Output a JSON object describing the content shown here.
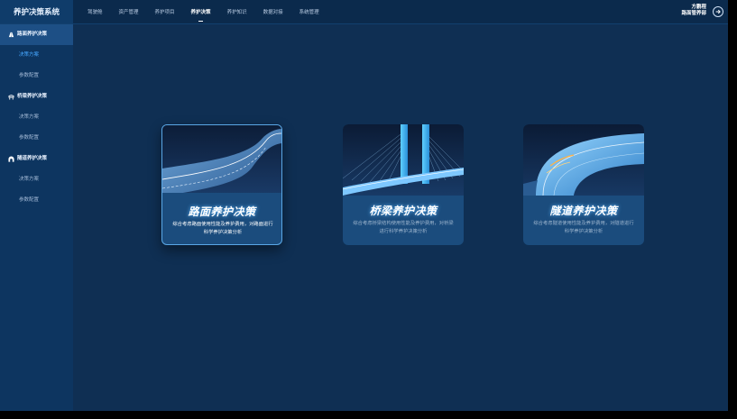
{
  "app": {
    "title": "养护决策系统"
  },
  "nav": {
    "tabs": [
      {
        "label": "驾驶舱"
      },
      {
        "label": "资产管理"
      },
      {
        "label": "养护项目"
      },
      {
        "label": "养护决策",
        "active": true
      },
      {
        "label": "养护知识"
      },
      {
        "label": "数据对接"
      },
      {
        "label": "系统管理"
      }
    ]
  },
  "user": {
    "name": "方鹏程",
    "org": "路面管养部"
  },
  "sidebar": {
    "groups": [
      {
        "label": "路面养护决策",
        "icon": "road-icon",
        "items": [
          {
            "label": "决策方案",
            "active": true
          },
          {
            "label": "参数配置"
          }
        ]
      },
      {
        "label": "桥梁养护决策",
        "icon": "bridge-icon",
        "items": [
          {
            "label": "决策方案"
          },
          {
            "label": "参数配置"
          }
        ]
      },
      {
        "label": "隧道养护决策",
        "icon": "tunnel-icon",
        "items": [
          {
            "label": "决策方案"
          },
          {
            "label": "参数配置"
          }
        ]
      }
    ]
  },
  "cards": [
    {
      "title": "路面养护决策",
      "desc": "综合考虑路面使用性能及养护费用，对路面进行科学养护决策分析",
      "image": "road-curve-image"
    },
    {
      "title": "桥梁养护决策",
      "desc": "综合考虑桥梁结构使用性能及养护费用，对桥梁进行科学养护决策分析",
      "image": "cable-bridge-image"
    },
    {
      "title": "隧道养护决策",
      "desc": "综合考虑隧道使用性能及养护费用，对隧道进行科学养护决策分析",
      "image": "tunnel-image"
    }
  ],
  "colors": {
    "background": "#0f2f53",
    "sidebar": "#0d3560",
    "accent": "#46a7ff",
    "card": "#1b4c7d"
  }
}
